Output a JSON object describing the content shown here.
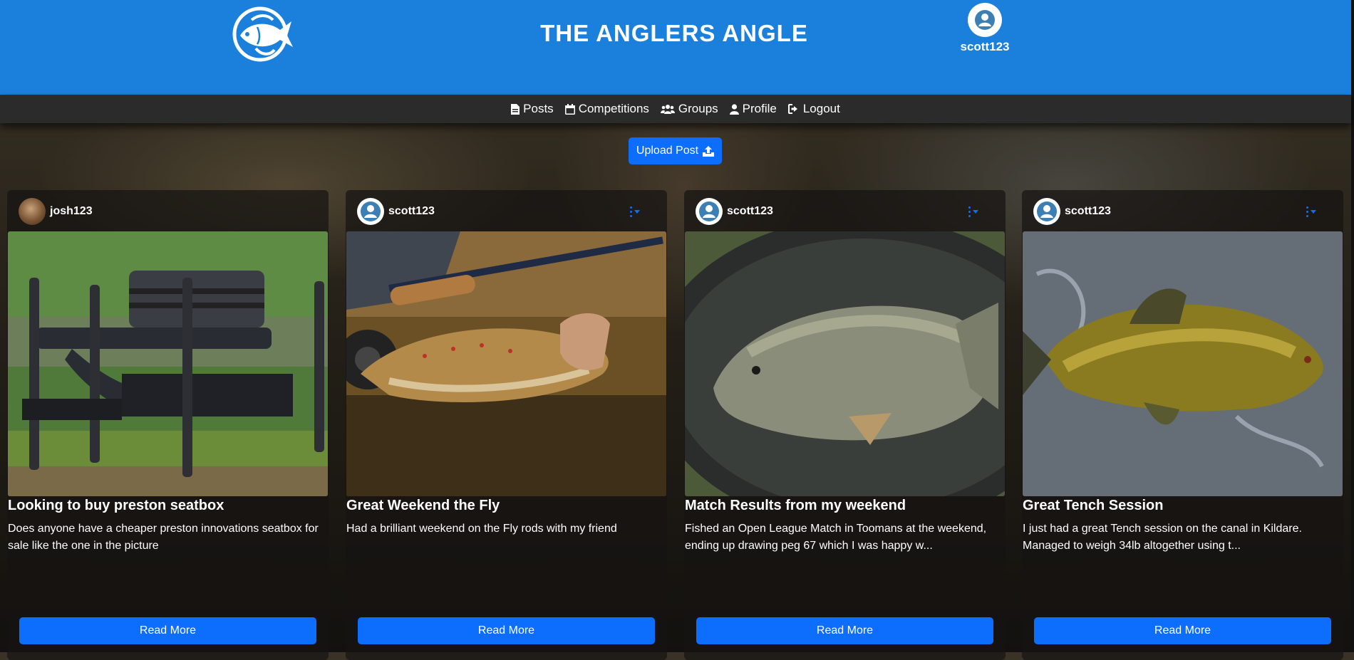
{
  "header": {
    "title": "THE ANGLERS ANGLE",
    "username": "scott123"
  },
  "nav": {
    "items": [
      {
        "label": "Posts",
        "icon": "file-icon"
      },
      {
        "label": "Competitions",
        "icon": "calendar-icon"
      },
      {
        "label": "Groups",
        "icon": "users-icon"
      },
      {
        "label": "Profile",
        "icon": "user-icon"
      },
      {
        "label": "Logout",
        "icon": "logout-icon"
      }
    ]
  },
  "upload_label": "Upload Post",
  "read_more_label": "Read More",
  "posts": [
    {
      "user": "josh123",
      "has_menu": false,
      "title": "Looking to buy preston seatbox",
      "description": "Does anyone have a cheaper preston innovations seatbox for sale like the one in the picture"
    },
    {
      "user": "scott123",
      "has_menu": true,
      "title": "Great Weekend the Fly",
      "description": "Had a brilliant weekend on the Fly rods with my friend"
    },
    {
      "user": "scott123",
      "has_menu": true,
      "title": "Match Results from my weekend",
      "description": "Fished an Open League Match in Toomans at the weekend, ending up drawing peg 67 which I was happy w..."
    },
    {
      "user": "scott123",
      "has_menu": true,
      "title": "Great Tench Session",
      "description": "I just had a great Tench session on the canal in Kildare. Managed to weigh 34lb altogether using t..."
    }
  ],
  "colors": {
    "header_bg": "#1a80dc",
    "nav_bg": "#2b2b2b",
    "primary": "#0d6efd"
  }
}
